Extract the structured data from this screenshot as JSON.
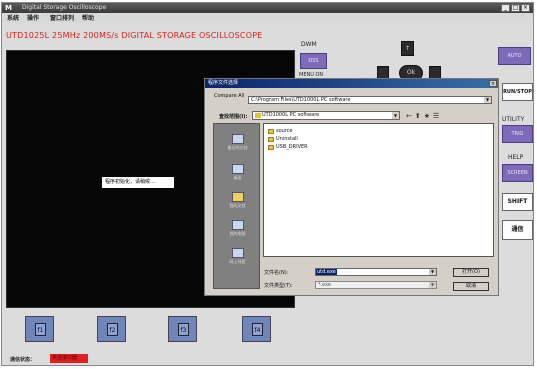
{
  "window": {
    "title": "Digital Storage Oscilloscope",
    "app_icon": "M",
    "controls": [
      "_",
      "□",
      "×"
    ]
  },
  "menu": [
    "系统",
    "操作",
    "窗口排列",
    "帮助"
  ],
  "scope": {
    "model_line": "UTD1025L 25MHz 200MS/s    DIGITAL STORAGE OSCILLOSCOPE",
    "waiting_message": "程序初始化，请稍候…",
    "channel_buttons": [
      "f1",
      "f2",
      "f3",
      "f4"
    ],
    "status_label": "通信状态：",
    "status_value": "未连接仪器"
  },
  "right_panel": {
    "label_top": "DWM",
    "label_second": "MENU ON",
    "purple_btn_1": "DSS",
    "knob_label": "Ok",
    "knob_top": "↑",
    "auto_label": "AUTO",
    "run_stop_label": "RUN/STOP",
    "utility_label": "UTILITY",
    "utility_btn": "TRIG",
    "help_label": "HELP",
    "help_btn": "SCREEN",
    "shift_label": "SHIFT",
    "connect_label": "通信"
  },
  "dialog": {
    "title": "程序文件选择",
    "path_label": "Compare All",
    "path_value": "C:\\Program Files\\UTD1000L PC software",
    "lookin_label": "查找范围(I):",
    "lookin_value": "UTD1000L PC software",
    "toolbar_icons": [
      "←",
      "⬆",
      "★",
      "☰"
    ],
    "places": [
      "最近的文档",
      "桌面",
      "我的文档",
      "我的电脑",
      "网上邻居"
    ],
    "files": [
      "source",
      "Uninstall",
      "USB_DRIVER"
    ],
    "filename_label": "文件名(N):",
    "filename_value": "utd.exe",
    "filetype_label": "文件类型(T):",
    "filetype_value": "*.exe",
    "open_button": "打开(O)",
    "cancel_button": "取消"
  }
}
